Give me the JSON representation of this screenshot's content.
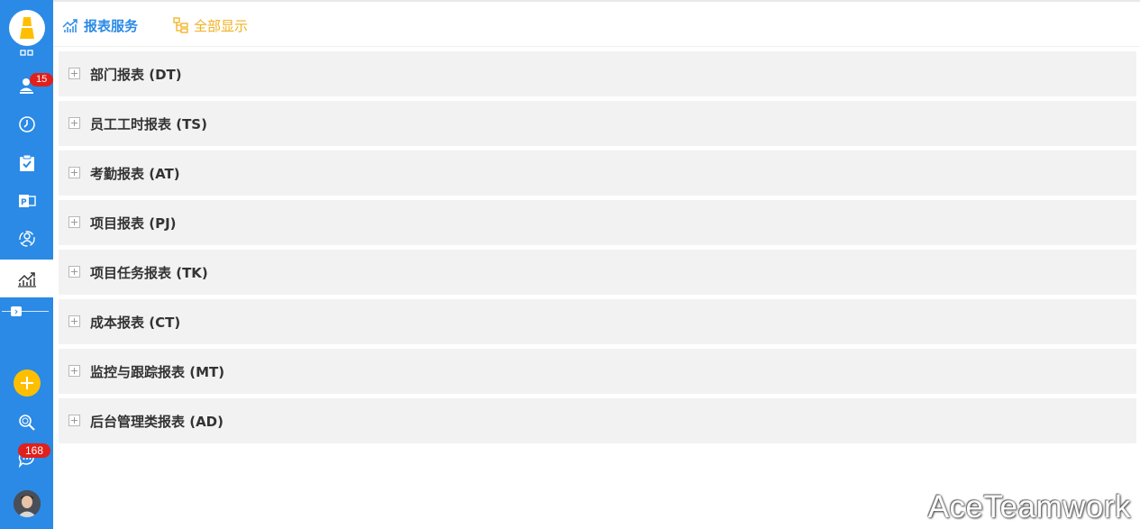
{
  "sidebar": {
    "items": [
      {
        "name": "grid-icon"
      },
      {
        "name": "person-icon",
        "badge": "15"
      },
      {
        "name": "clock-icon"
      },
      {
        "name": "clipboard-check-icon"
      },
      {
        "name": "project-icon"
      },
      {
        "name": "team-icon"
      },
      {
        "name": "chart-icon",
        "active": true
      }
    ],
    "messages_badge": "168",
    "colors": {
      "background": "#2a8ae6",
      "badge": "#e0201b",
      "add_button": "#ffbf00"
    }
  },
  "toolbar": {
    "report_service_label": "报表服务",
    "show_all_label": "全部显示"
  },
  "reports": [
    {
      "label": "部门报表 (DT)"
    },
    {
      "label": "员工工时报表 (TS)"
    },
    {
      "label": "考勤报表 (AT)"
    },
    {
      "label": "项目报表 (PJ)"
    },
    {
      "label": "项目任务报表 (TK)"
    },
    {
      "label": "成本报表 (CT)"
    },
    {
      "label": "监控与跟踪报表 (MT)"
    },
    {
      "label": "后台管理类报表 (AD)"
    }
  ],
  "watermark": "AceTeamwork"
}
